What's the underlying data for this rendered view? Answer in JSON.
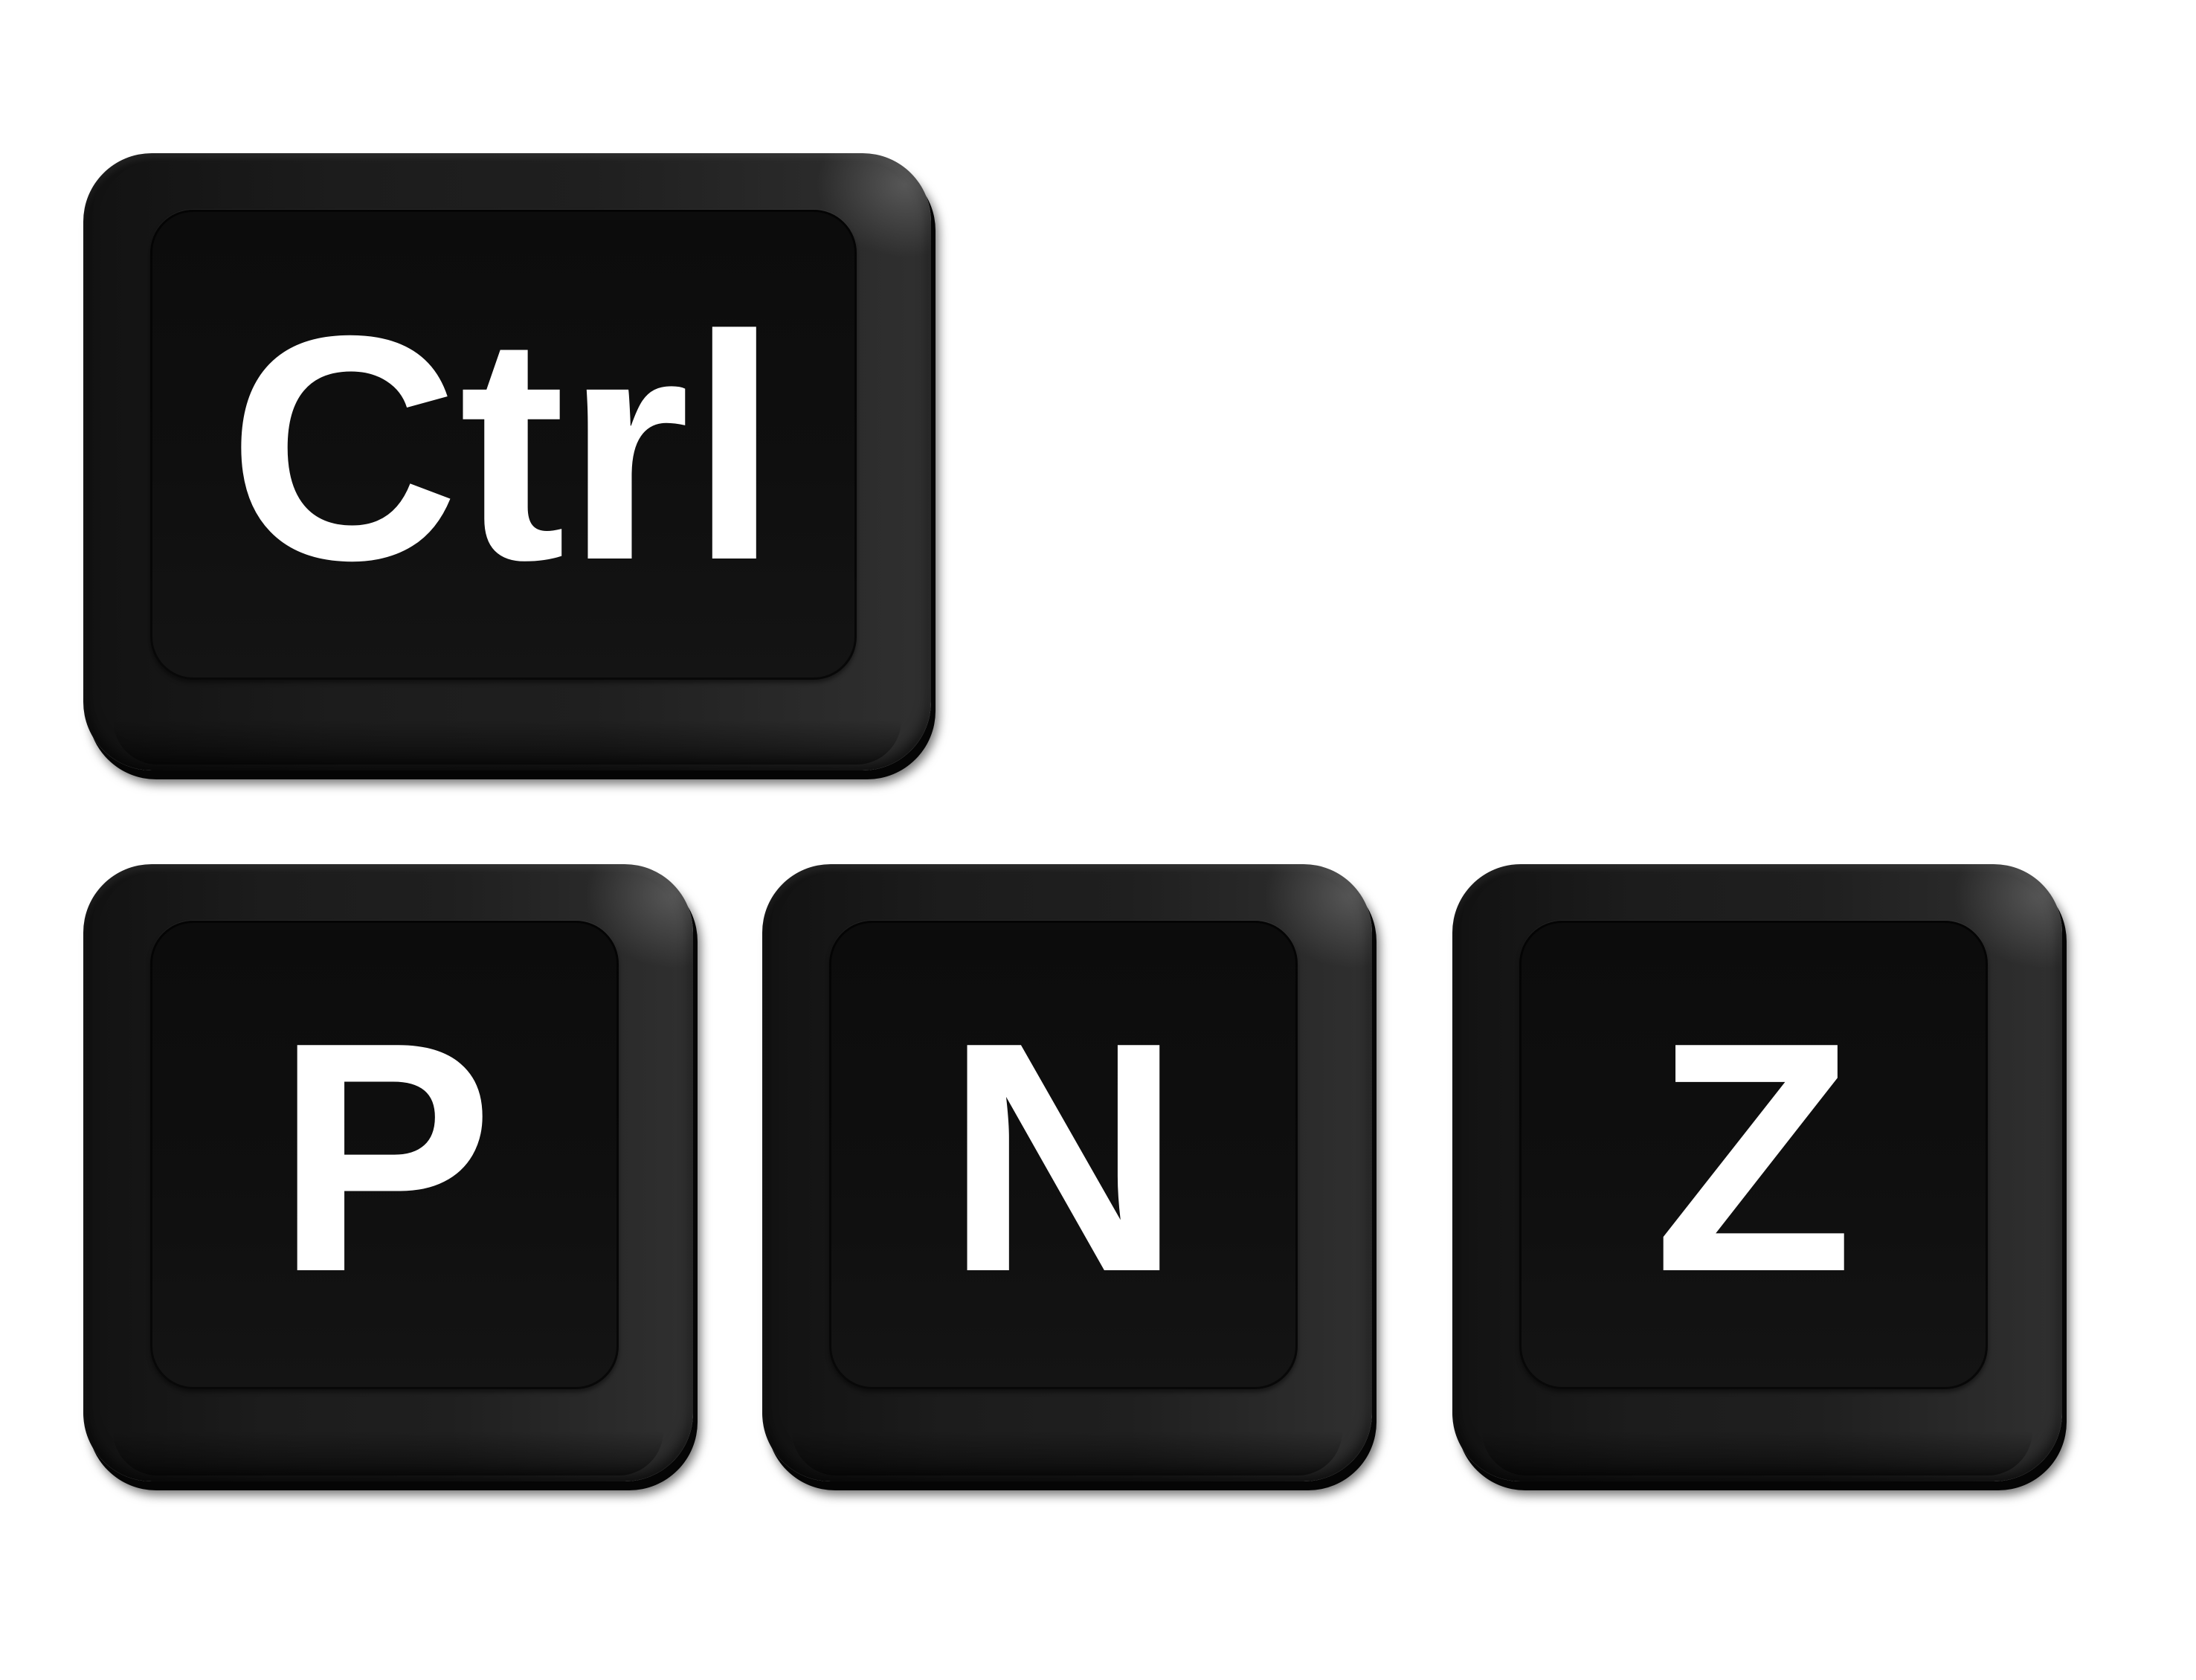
{
  "keys": {
    "ctrl": {
      "label": "Ctrl"
    },
    "p": {
      "label": "P"
    },
    "n": {
      "label": "N"
    },
    "z": {
      "label": "Z"
    }
  },
  "colors": {
    "background": "#ffffff",
    "keycap": "#1a1a1a",
    "keyface": "#0e0e0e",
    "label": "#ffffff"
  }
}
